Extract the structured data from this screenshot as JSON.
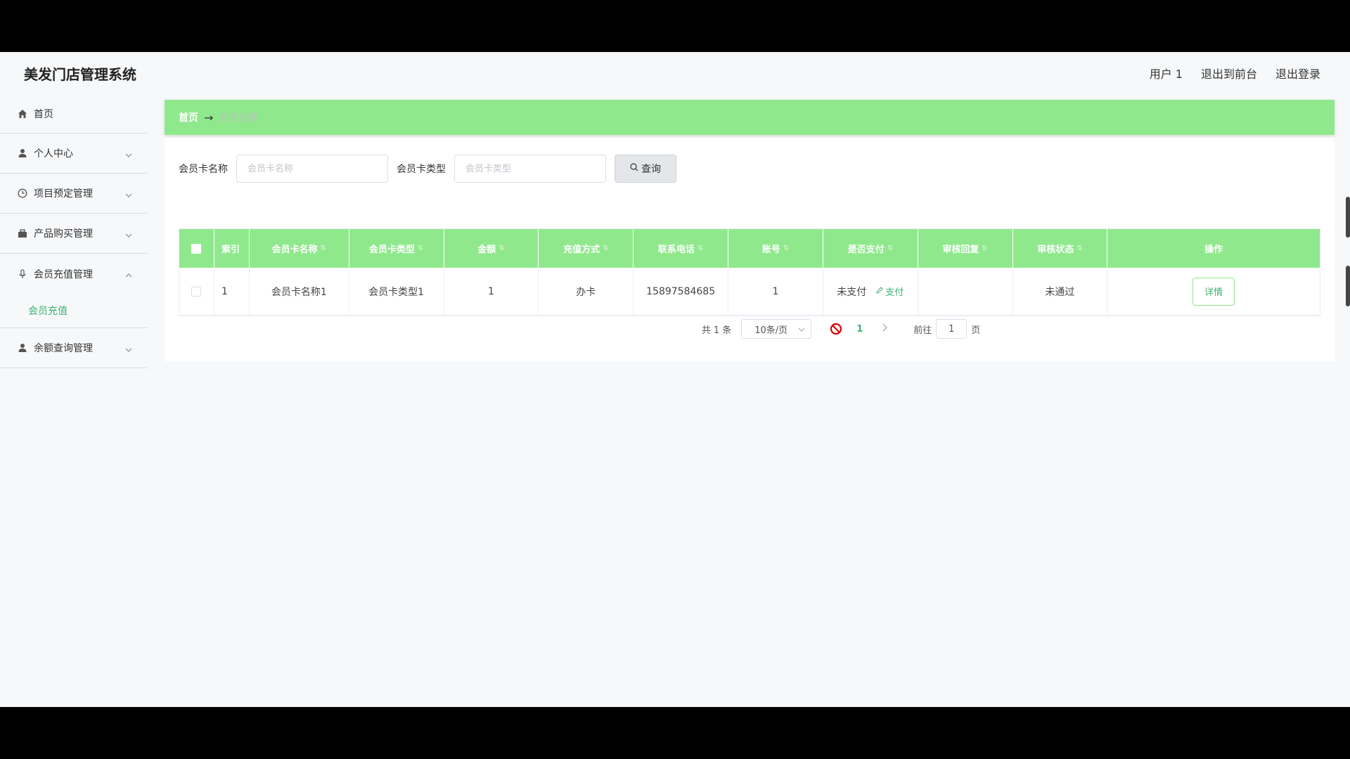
{
  "app": {
    "title": "美发门店管理系统"
  },
  "header": {
    "user": "用户 1",
    "to_front": "退出到前台",
    "logout": "退出登录"
  },
  "sidebar": {
    "items": [
      {
        "label": "首页",
        "icon": "home-icon"
      },
      {
        "label": "个人中心",
        "icon": "user-icon"
      },
      {
        "label": "项目预定管理",
        "icon": "clock-icon"
      },
      {
        "label": "产品购买管理",
        "icon": "briefcase-icon"
      },
      {
        "label": "会员充值管理",
        "icon": "microphone-icon",
        "expanded": true
      },
      {
        "label": "余额查询管理",
        "icon": "user-icon"
      }
    ],
    "submenu": {
      "label": "会员充值"
    }
  },
  "breadcrumb": {
    "home": "首页",
    "arrow": "→",
    "current": "会员充值"
  },
  "search": {
    "name_label": "会员卡名称",
    "name_placeholder": "会员卡名称",
    "type_label": "会员卡类型",
    "type_placeholder": "会员卡类型",
    "button": "查询"
  },
  "table": {
    "headers": [
      "索引",
      "会员卡名称",
      "会员卡类型",
      "金额",
      "充值方式",
      "联系电话",
      "账号",
      "是否支付",
      "审核回复",
      "审核状态",
      "操作"
    ],
    "rows": [
      {
        "index": "1",
        "card_name": "会员卡名称1",
        "card_type": "会员卡类型1",
        "amount": "1",
        "method": "办卡",
        "phone": "15897584685",
        "account": "1",
        "paid": "未支付",
        "pay_action": "支付",
        "reply": "",
        "status": "未通过",
        "detail": "详情"
      }
    ]
  },
  "pagination": {
    "total": "共 1 条",
    "page_size": "10条/页",
    "current_page": "1",
    "goto_label": "前往",
    "goto_value": "1",
    "page_unit": "页"
  },
  "colors": {
    "accent": "#8fe98c",
    "link": "#3cb371"
  }
}
